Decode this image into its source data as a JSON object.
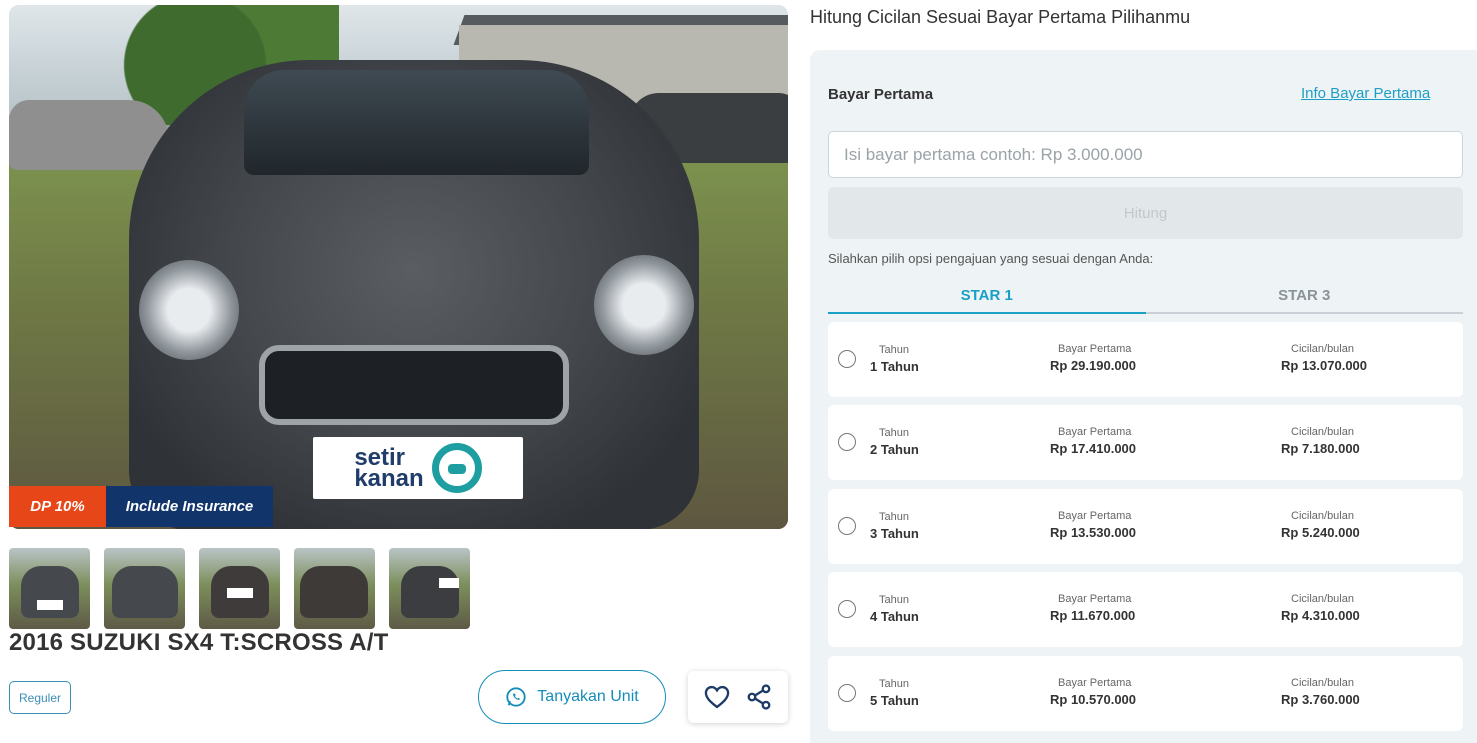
{
  "gallery": {
    "badges": {
      "dp": "DP 10%",
      "insurance": "Include Insurance"
    },
    "plate_brand": [
      "setir",
      "kanan"
    ],
    "thumbnail_count": 5
  },
  "listing": {
    "title": "2016 SUZUKI SX4 T:SCROSS A/T",
    "tag": "Reguler",
    "ask_button": "Tanyakan Unit"
  },
  "calculator": {
    "heading": "Hitung Cicilan Sesuai Bayar Pertama Pilihanmu",
    "down_payment_label": "Bayar Pertama",
    "info_link": "Info Bayar Pertama",
    "input_placeholder": "Isi bayar pertama contoh: Rp 3.000.000",
    "submit_label": "Hitung",
    "hint": "Silahkan pilih opsi pengajuan yang sesuai dengan Anda:",
    "tabs": [
      {
        "label": "STAR 1",
        "active": true
      },
      {
        "label": "STAR 3",
        "active": false
      }
    ],
    "options": [
      {
        "tenor_label": "Tahun",
        "tenor": "1 Tahun",
        "dp_label": "Bayar Pertama",
        "dp": "Rp 29.190.000",
        "installment_label": "Cicilan/bulan",
        "installment": "Rp 13.070.000"
      },
      {
        "tenor_label": "Tahun",
        "tenor": "2 Tahun",
        "dp_label": "Bayar Pertama",
        "dp": "Rp 17.410.000",
        "installment_label": "Cicilan/bulan",
        "installment": "Rp 7.180.000"
      },
      {
        "tenor_label": "Tahun",
        "tenor": "3 Tahun",
        "dp_label": "Bayar Pertama",
        "dp": "Rp 13.530.000",
        "installment_label": "Cicilan/bulan",
        "installment": "Rp 5.240.000"
      },
      {
        "tenor_label": "Tahun",
        "tenor": "4 Tahun",
        "dp_label": "Bayar Pertama",
        "dp": "Rp 11.670.000",
        "installment_label": "Cicilan/bulan",
        "installment": "Rp 4.310.000"
      },
      {
        "tenor_label": "Tahun",
        "tenor": "5 Tahun",
        "dp_label": "Bayar Pertama",
        "dp": "Rp 10.570.000",
        "installment_label": "Cicilan/bulan",
        "installment": "Rp 3.760.000"
      }
    ]
  },
  "colors": {
    "accent": "#18a0c7",
    "dp_badge": "#e74619",
    "insurance_badge": "#11346a",
    "panel_bg": "#eef3f6"
  },
  "icons": [
    "whatsapp-icon",
    "heart-icon",
    "share-icon"
  ]
}
